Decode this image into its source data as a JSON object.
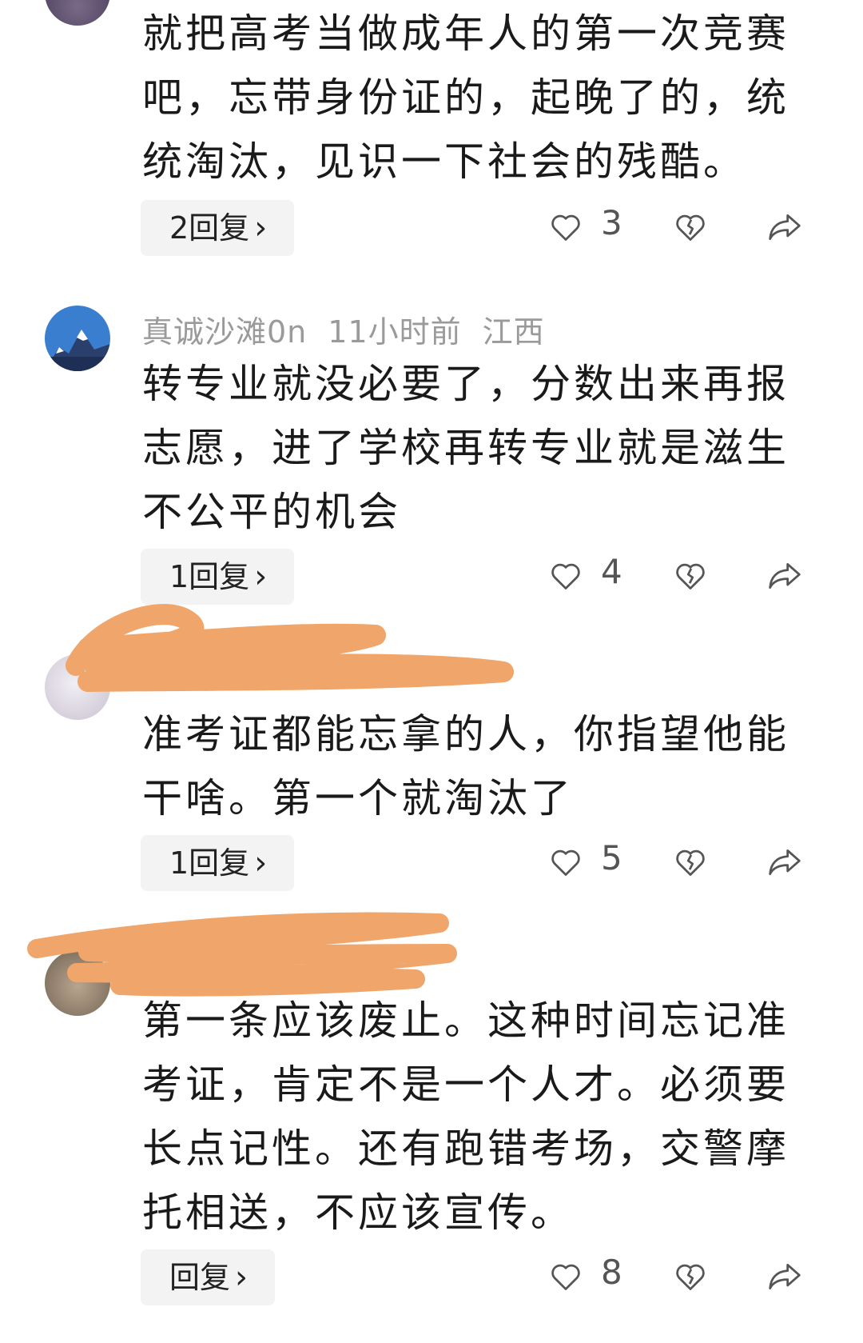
{
  "comments": [
    {
      "user": "",
      "time": "",
      "location": "",
      "lines": [
        "就把高考当做成年人的第一次竞赛",
        "吧，忘带身份证的，起晚了的，统",
        "统淘汰，见识一下社会的残酷。"
      ],
      "reply_label": "2回复",
      "likes": "3"
    },
    {
      "user": "真诚沙滩0n",
      "time": "11小时前",
      "location": "江西",
      "lines": [
        "转专业就没必要了，分数出来再报",
        "志愿，进了学校再转专业就是滋生",
        "不公平的机会"
      ],
      "reply_label": "1回复",
      "likes": "4"
    },
    {
      "user": "",
      "time": "",
      "location": "",
      "lines": [
        "准考证都能忘拿的人，你指望他能",
        "干啥。第一个就淘汰了"
      ],
      "reply_label": "1回复",
      "likes": "5"
    },
    {
      "user": "",
      "time": "",
      "location": "",
      "lines": [
        "第一条应该废止。这种时间忘记准",
        "考证，肯定不是一个人才。必须要",
        "长点记性。还有跑错考场，交警摩",
        "托相送，不应该宣传。"
      ],
      "reply_label": "回复",
      "likes": "8"
    }
  ],
  "icons": {
    "like": "heart-outline-icon",
    "dislike": "broken-heart-icon",
    "share": "share-arrow-icon",
    "chevron": "chevron-right-icon"
  },
  "colors": {
    "redaction": "#f0a56a",
    "meta_text": "#9a9a9a",
    "body_text": "#1a1a1a",
    "reply_bg": "#f3f3f3"
  }
}
